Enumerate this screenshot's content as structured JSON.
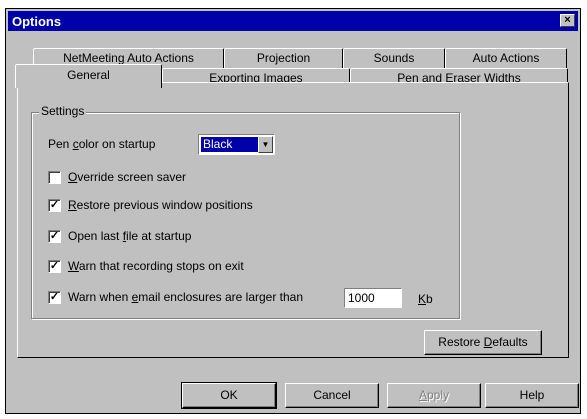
{
  "window": {
    "title": "Options",
    "close_glyph": "×"
  },
  "tabs_row1": [
    {
      "label": "NetMeeting Auto Actions"
    },
    {
      "label": "Projection"
    },
    {
      "label": "Sounds"
    },
    {
      "label": "Auto Actions"
    }
  ],
  "tabs_row2": [
    {
      "label": "General",
      "selected": true
    },
    {
      "label": "Exporting Images"
    },
    {
      "label": "Pen and Eraser Widths"
    }
  ],
  "settings": {
    "group_title": "Settings",
    "pen_color_label_pre": "Pen ",
    "pen_color_label_accel": "c",
    "pen_color_label_post": "olor on startup",
    "pen_color_value": "Black",
    "options": [
      {
        "accel": "O",
        "rest": "verride screen saver",
        "checked": false
      },
      {
        "accel": "R",
        "rest": "estore previous window positions",
        "checked": true
      },
      {
        "pre": "Open last ",
        "accel": "f",
        "rest": "ile at startup",
        "checked": true
      },
      {
        "pre": "",
        "accel": "W",
        "rest": "arn that recording stops on exit",
        "checked": true
      },
      {
        "pre": "Warn when ",
        "accel": "e",
        "rest": "mail enclosures are larger than",
        "checked": true
      }
    ],
    "size_limit": "1000",
    "size_unit_accel": "K",
    "size_unit_rest": "b"
  },
  "buttons": {
    "restore_pre": "Restore ",
    "restore_accel": "D",
    "restore_rest": "efaults",
    "ok": "OK",
    "cancel": "Cancel",
    "apply_accel": "A",
    "apply_rest": "pply",
    "help": "Help"
  }
}
